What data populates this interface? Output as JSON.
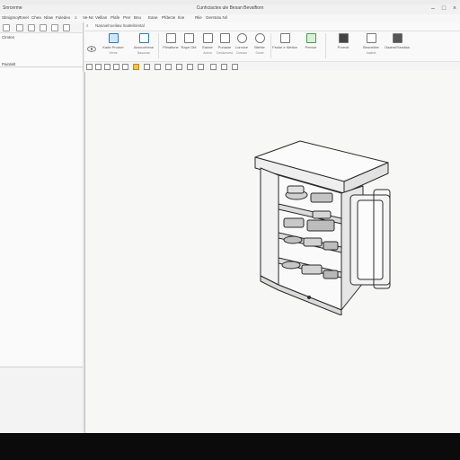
{
  "window": {
    "app_name": "Snrcerme",
    "title": "Cunhciactes ule Besan Bevalfiorn"
  },
  "menu": [
    "Sbnigmoy",
    "Tonel",
    "Chea",
    "Nlaw",
    "Fuledeo",
    "≡",
    "Ve-Nc",
    "Vellian",
    "Plafe",
    "Prer",
    "Bnu",
    "Eane",
    "Pfdecte",
    "Iloe",
    "Rlie",
    "Gerstotu Nil"
  ],
  "left_panel": {
    "tab_label": "Clmtes",
    "section_label": "Pairdelt"
  },
  "ribbon": {
    "tab": "Nanaiehoeilaw lIoaleibiretal",
    "groups": [
      {
        "label": "Kade Prumer",
        "sub": "Veme",
        "icon": "cloud-icon"
      },
      {
        "label": "Aewcorhene",
        "sub": "Basonan",
        "icon": "grid-icon"
      },
      {
        "label": "Plinaltone",
        "sub": "",
        "icon": "table-icon"
      },
      {
        "label": "Rape Obl",
        "sub": "",
        "icon": "window-icon"
      },
      {
        "label": "Eanee",
        "sub": "Areon",
        "icon": "component-icon"
      },
      {
        "label": "Ponaste",
        "sub": "Deolonvest",
        "icon": "shape-icon"
      },
      {
        "label": "Lonnice",
        "sub": "Coeson",
        "icon": "bulb-icon"
      },
      {
        "label": "Btehte",
        "sub": "Sonle",
        "icon": "lamp-icon"
      },
      {
        "label": "Feoke e Wetice",
        "sub": "",
        "icon": "brush-icon"
      },
      {
        "label": "Pemoe",
        "sub": "",
        "icon": "image-icon"
      },
      {
        "label": "Poreotl",
        "sub": "",
        "icon": "layers-icon"
      },
      {
        "label": "Beoneliee",
        "sub": "Inaleot",
        "icon": "print-icon"
      },
      {
        "label": "Oaahel/Sewlian",
        "sub": "",
        "icon": "export-icon"
      }
    ]
  },
  "colors": {
    "accent": "#2a7ab8",
    "folder": "#d9a73b",
    "canvas": "#f7f7f5",
    "taskbar": "#0b0b0b"
  }
}
